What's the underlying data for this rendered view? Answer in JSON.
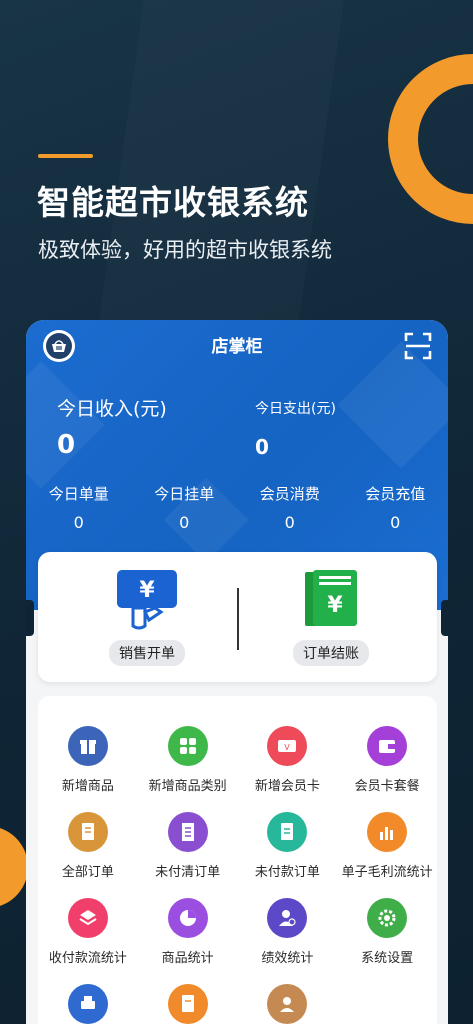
{
  "hero": {
    "title": "智能超市收银系统",
    "subtitle": "极致体验，好用的超市收银系统"
  },
  "header": {
    "title": "店掌柜"
  },
  "summary": {
    "income_label": "今日收入(元)",
    "income_value": "0",
    "expense_label": "今日支出(元)",
    "expense_value": "0"
  },
  "stats": [
    {
      "label": "今日单量",
      "value": "0"
    },
    {
      "label": "今日挂单",
      "value": "0"
    },
    {
      "label": "会员消费",
      "value": "0"
    },
    {
      "label": "会员充值",
      "value": "0"
    }
  ],
  "quick": {
    "sale_label": "销售开单",
    "checkout_label": "订单结账"
  },
  "grid": [
    {
      "label": "新增商品",
      "icon": "gift-icon",
      "color": "#3c64b8"
    },
    {
      "label": "新增商品类别",
      "icon": "category-grid-icon",
      "color": "#3fb84a"
    },
    {
      "label": "新增会员卡",
      "icon": "vip-card-icon",
      "color": "#ef4a5a"
    },
    {
      "label": "会员卡套餐",
      "icon": "wallet-icon",
      "color": "#a43fd8"
    },
    {
      "label": "全部订单",
      "icon": "order-doc-icon",
      "color": "#d8953a"
    },
    {
      "label": "未付清订单",
      "icon": "receipt-icon",
      "color": "#8a4fd1"
    },
    {
      "label": "未付款订单",
      "icon": "unpaid-doc-icon",
      "color": "#27b79a"
    },
    {
      "label": "单子毛利流统计",
      "icon": "bar-chart-icon",
      "color": "#f28a2a"
    },
    {
      "label": "收付款流统计",
      "icon": "layers-icon",
      "color": "#ef3f6a"
    },
    {
      "label": "商品统计",
      "icon": "pie-chart-icon",
      "color": "#9b4fe0"
    },
    {
      "label": "绩效统计",
      "icon": "user-performance-icon",
      "color": "#5b49c8"
    },
    {
      "label": "系统设置",
      "icon": "gear-icon",
      "color": "#3fae48"
    },
    {
      "label": "",
      "icon": "printer-icon",
      "color": "#2f6ad0"
    },
    {
      "label": "",
      "icon": "report-doc-icon",
      "color": "#f08a2a"
    },
    {
      "label": "",
      "icon": "staff-icon",
      "color": "#c58a52"
    }
  ]
}
